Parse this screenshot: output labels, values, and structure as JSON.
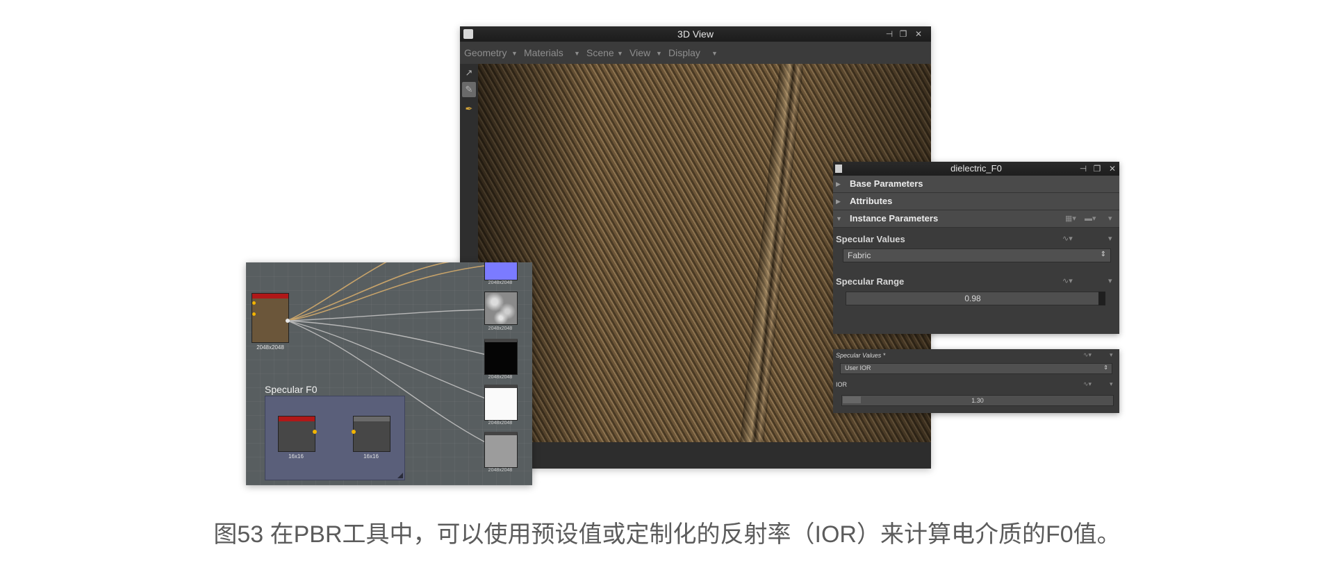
{
  "view3d": {
    "title": "3D View",
    "menus": [
      "Geometry",
      "Materials",
      "Scene",
      "View",
      "Display"
    ],
    "window_buttons": [
      "pin",
      "restore",
      "close"
    ]
  },
  "dielectric_panel": {
    "title": "dielectric_F0",
    "sections": {
      "base": "Base Parameters",
      "attributes": "Attributes",
      "instance": "Instance Parameters"
    },
    "specular_values": {
      "label": "Specular Values",
      "value": "Fabric"
    },
    "specular_range": {
      "label": "Specular Range",
      "value": "0.98",
      "level": 0.98
    }
  },
  "ior_panel": {
    "specular_values_label": "Specular Values *",
    "specular_values_value": "User IOR",
    "ior_label": "IOR",
    "ior_value": "1.30"
  },
  "node_graph": {
    "frame_title": "Specular F0",
    "main_node_caption": "2048x2048",
    "outputs": [
      {
        "caption": "2048x2048",
        "kind": "normal"
      },
      {
        "caption": "2048x2048",
        "kind": "noise"
      },
      {
        "caption": "2048x2048",
        "kind": "black"
      },
      {
        "caption": "2048x2048",
        "kind": "white"
      },
      {
        "caption": "2048x2048",
        "kind": "gray"
      }
    ],
    "frame_nodes": [
      "16x16",
      "16x16"
    ]
  },
  "caption": "图53 在PBR工具中，可以使用预设值或定制化的反射率（IOR）来计算电介质的F0值。",
  "colors": {
    "accent_red": "#b01818",
    "normal_map": "#7b7bff",
    "wire": "#c7a36a",
    "wire_gray": "#b8b8b8"
  }
}
